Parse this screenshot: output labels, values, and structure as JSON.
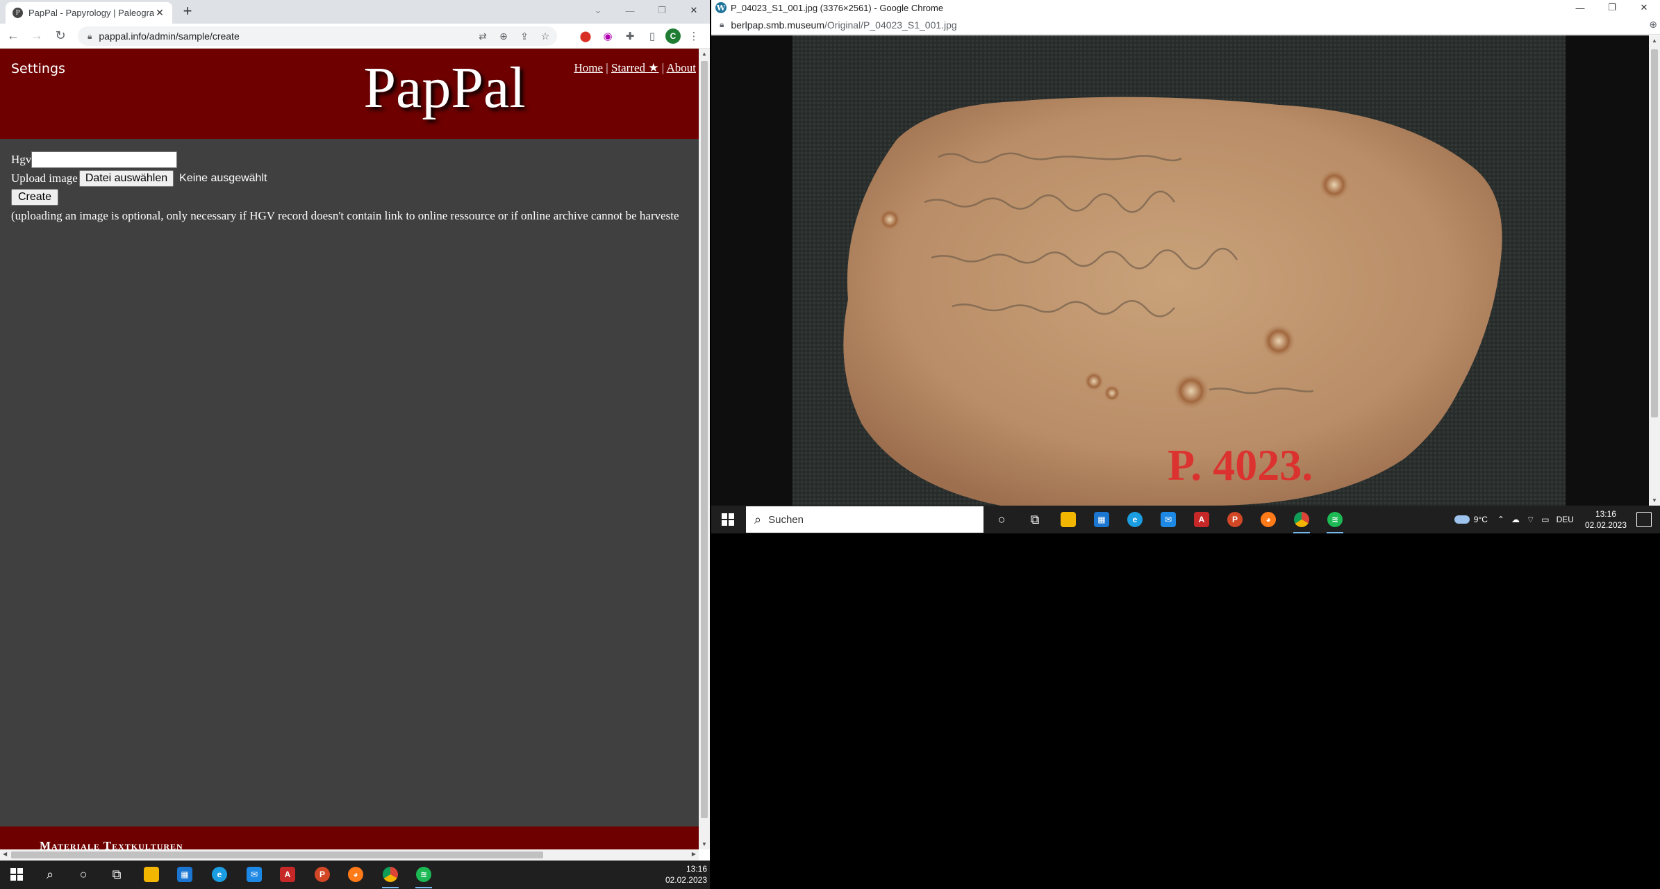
{
  "left_window": {
    "tab_title": "PapPal - Papyrology | Paleograph",
    "url": "pappal.info/admin/sample/create",
    "nav_back": "←",
    "nav_forward": "→",
    "nav_reload": "↻",
    "new_tab": "+",
    "profile_initial": "C",
    "page": {
      "settings_label": "Settings",
      "logo": "PapPal",
      "nav": {
        "home": "Home",
        "sep1": "|",
        "starred": "Starred ★",
        "sep2": "|",
        "about": "About"
      },
      "form": {
        "hgv_label": "Hgv",
        "hgv_value": "",
        "upload_label": "Upload image",
        "file_button": "Datei auswählen",
        "no_file": "Keine ausgewählt",
        "create_button": "Create",
        "note": "(uploading an image is optional, only necessary if HGV record doesn't contain link to online ressource or if online archive cannot be harveste"
      },
      "footer_text": "Materiale Textkulturen"
    }
  },
  "right_window": {
    "title": "P_04023_S1_001.jpg (3376×2561) - Google Chrome",
    "url_host": "berlpap.smb.museum",
    "url_path": "/Original/P_04023_S1_001.jpg",
    "image_label": "P. 4023."
  },
  "right_taskbar": {
    "search_placeholder": "Suchen",
    "weather": "9°C",
    "language": "DEU",
    "time": "13:16",
    "date": "02.02.2023"
  },
  "left_taskbar": {
    "time": "13:16",
    "date": "02.02.2023"
  },
  "colors": {
    "header_bg": "#6e0000",
    "content_bg": "#404040",
    "taskbar_bg": "#1f1f1f",
    "chrome_tab_bg": "#dee1e6"
  }
}
